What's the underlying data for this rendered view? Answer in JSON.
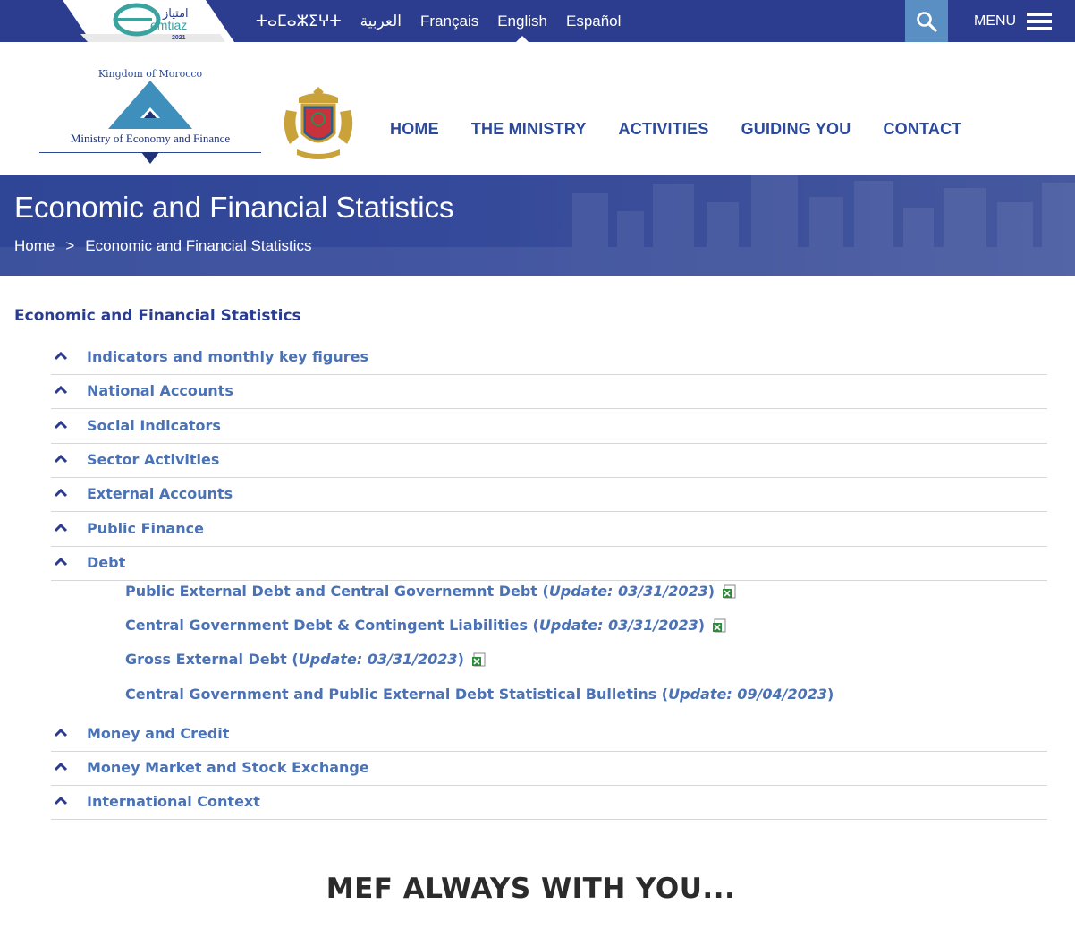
{
  "topbar": {
    "badge_text": "emtiaz",
    "badge_year": "2021",
    "badge_arabic": "امتياز",
    "languages": [
      {
        "label": "ⵜⴰⵎⴰⵣⵉⵖⵜ",
        "active": false
      },
      {
        "label": "العربية",
        "active": false
      },
      {
        "label": "Français",
        "active": false
      },
      {
        "label": "English",
        "active": true
      },
      {
        "label": "Español",
        "active": false
      }
    ],
    "search_icon": "search-icon",
    "menu_label": "MENU",
    "menu_icon": "hamburger-icon"
  },
  "header": {
    "logo_kingdom": "Kingdom of Morocco",
    "logo_name": "Ministry of Economy and Finance",
    "nav": [
      "HOME",
      "THE MINISTRY",
      "ACTIVITIES",
      "GUIDING YOU",
      "CONTACT"
    ]
  },
  "banner": {
    "title": "Economic and Financial Statistics",
    "breadcrumb_home": "Home",
    "breadcrumb_sep": ">",
    "breadcrumb_current": "Economic and Financial Statistics"
  },
  "content": {
    "section_title": "Economic and Financial Statistics",
    "accordion": [
      "Indicators and monthly key figures",
      "National Accounts",
      "Social Indicators",
      "Sector Activities",
      "External Accounts",
      "Public Finance",
      "Debt",
      "Money and Credit",
      "Money Market and Stock Exchange",
      "International Context"
    ],
    "debt_items": [
      {
        "label": "Public External Debt and Central Governemnt Debt",
        "update": "Update: 03/31/2023",
        "has_xls": true
      },
      {
        "label": "Central Government Debt & Contingent Liabilities",
        "update": "Update: 03/31/2023",
        "has_xls": true
      },
      {
        "label": "Gross External Debt",
        "update": "Update: 03/31/2023",
        "has_xls": true
      },
      {
        "label": "Central Government and Public External Debt Statistical Bulletins",
        "update": "Update: 09/04/2023",
        "has_xls": false
      }
    ]
  },
  "footer": {
    "tagline": "MEF ALWAYS WITH YOU..."
  },
  "colors": {
    "navy": "#2c3d8f",
    "search_blue": "#5a8fc3",
    "link_blue": "#4a72b5",
    "nav_blue": "#2b4a9c"
  }
}
